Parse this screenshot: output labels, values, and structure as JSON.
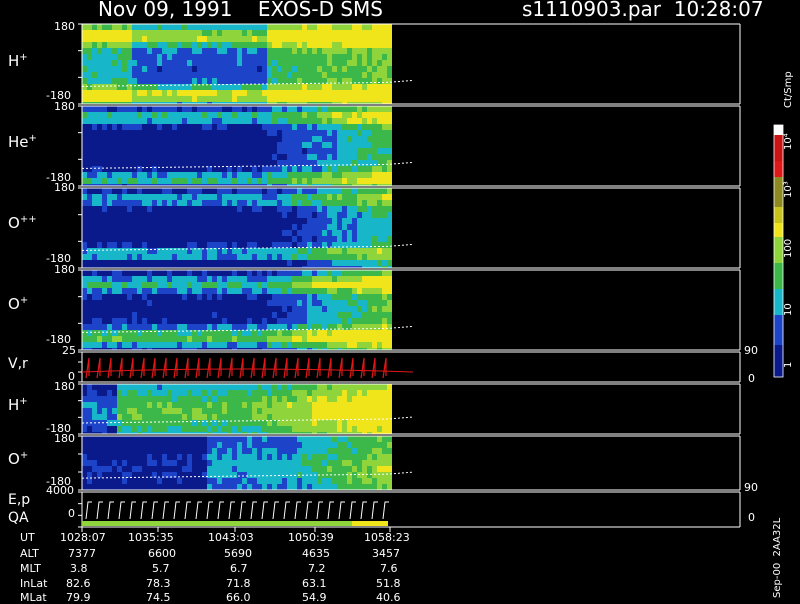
{
  "header": {
    "title": "Nov 09, 1991    EXOS-D SMS",
    "file": "s1110903.par  10:28:07"
  },
  "panels": [
    {
      "label": "H",
      "sup": "+",
      "ytop": "180",
      "ybot": "-180"
    },
    {
      "label": "He",
      "sup": "+",
      "ytop": "180",
      "ybot": "-180"
    },
    {
      "label": "O",
      "sup": "++",
      "ytop": "180",
      "ybot": "-180"
    },
    {
      "label": "O",
      "sup": "+",
      "ytop": "180",
      "ybot": "-180"
    },
    {
      "label": "V,r",
      "sup": "",
      "ytop": "25",
      "ybot": "0",
      "rtop": "90",
      "rbot": "0"
    },
    {
      "label": "H",
      "sup": "+",
      "ytop": "180",
      "ybot": "-180"
    },
    {
      "label": "O",
      "sup": "+",
      "ytop": "180",
      "ybot": "-180"
    },
    {
      "label": "E,p",
      "sup": "",
      "label2": "QA",
      "ytop": "4000",
      "ybot": "0",
      "rtop": "90",
      "rbot": "0"
    }
  ],
  "colorbar": {
    "unit": "Ct/Smp",
    "ticks": [
      "10⁴",
      "10³",
      "100",
      "10",
      "1"
    ]
  },
  "ephemeris": {
    "rows": [
      {
        "name": "UT",
        "values": [
          "1028:07",
          "1035:35",
          "1043:03",
          "1050:39",
          "1058:23"
        ]
      },
      {
        "name": "ALT",
        "values": [
          "7377",
          "6600",
          "5690",
          "4635",
          "3457"
        ]
      },
      {
        "name": "MLT",
        "values": [
          "3.8",
          "5.7",
          "6.7",
          "7.2",
          "7.6"
        ]
      },
      {
        "name": "InLat",
        "values": [
          "82.6",
          "78.3",
          "71.8",
          "63.1",
          "51.8"
        ]
      },
      {
        "name": "MLat",
        "values": [
          "79.9",
          "74.5",
          "66.0",
          "54.9",
          "40.6"
        ]
      }
    ]
  },
  "footer_note": "Sep-00  2AA32L",
  "chart_data": {
    "type": "heatmap",
    "title": "Nov 09, 1991    EXOS-D SMS",
    "file": "s1110903.par  10:28:07",
    "x_tick_labels": [
      "1028:07",
      "1035:35",
      "1043:03",
      "1050:39",
      "1058:23"
    ],
    "y_range": [
      -180,
      180
    ],
    "colorbar_scale": "log",
    "colorbar_range": [
      1,
      10000
    ],
    "colors": {
      "navy": "#0a1a8a",
      "blue": "#1d44c8",
      "cyan": "#17b6c8",
      "green": "#3cb84a",
      "ltgreen": "#8ed43a",
      "yellow": "#f0e41a",
      "olive": "#8c8a20",
      "red": "#e01818",
      "white": "#ffffff"
    }
  }
}
